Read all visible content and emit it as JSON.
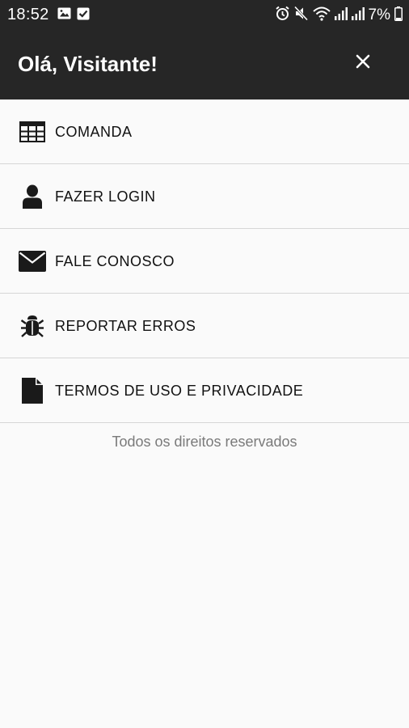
{
  "status_bar": {
    "time": "18:52",
    "left_icons": [
      "image-icon",
      "checkbox-icon"
    ],
    "right_icons": [
      "alarm-icon",
      "mute-icon",
      "wifi-icon",
      "signal-icon",
      "signal-icon",
      "battery-icon"
    ],
    "battery": "7%"
  },
  "header": {
    "title": "Olá, Visitante!",
    "close_icon": "close-icon",
    "background_color": "#262626"
  },
  "menu": {
    "items": [
      {
        "label": "COMANDA",
        "icon": "table-grid-icon"
      },
      {
        "label": "FAZER LOGIN",
        "icon": "user-icon"
      },
      {
        "label": "FALE CONOSCO",
        "icon": "envelope-icon"
      },
      {
        "label": "REPORTAR ERROS",
        "icon": "bug-icon"
      },
      {
        "label": "TERMOS DE USO E PRIVACIDADE",
        "icon": "file-icon"
      }
    ]
  },
  "footer": {
    "text": "Todos os direitos reservados"
  }
}
